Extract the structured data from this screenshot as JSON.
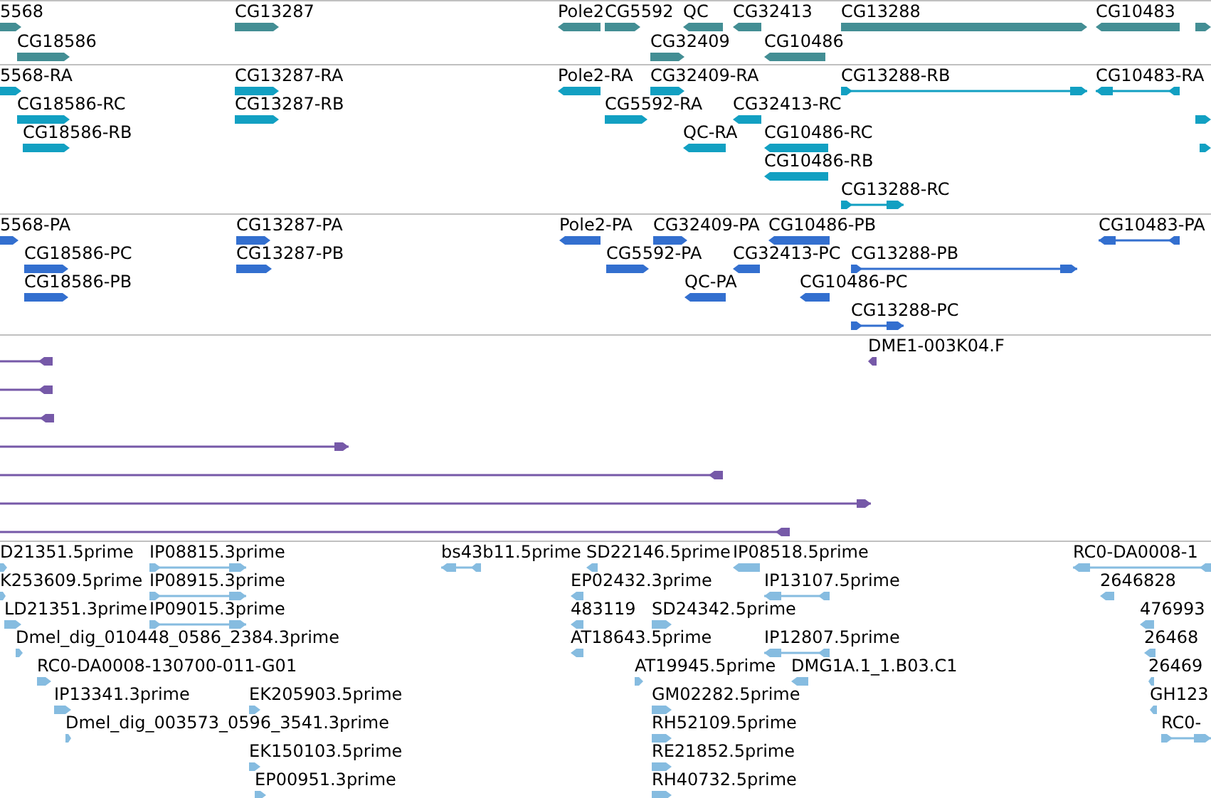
{
  "tracks": [
    {
      "color": "#438e94",
      "features": [
        {
          "label": "5568",
          "forward": true,
          "kind": "block"
        },
        {
          "label": "CG18586",
          "forward": true,
          "kind": "block"
        },
        {
          "label": "CG13287",
          "forward": true,
          "kind": "block"
        },
        {
          "label": "Pole2",
          "forward": false,
          "kind": "block"
        },
        {
          "label": "CG5592",
          "forward": true,
          "kind": "block"
        },
        {
          "label": "QC",
          "forward": false,
          "kind": "block"
        },
        {
          "label": "CG32409",
          "forward": true,
          "kind": "block"
        },
        {
          "label": "CG32413",
          "forward": false,
          "kind": "block"
        },
        {
          "label": "CG10486",
          "forward": false,
          "kind": "block"
        },
        {
          "label": "CG13288",
          "forward": true,
          "kind": "block"
        },
        {
          "label": "CG10483",
          "forward": false,
          "kind": "block"
        },
        {
          "forward": true,
          "kind": "block"
        }
      ]
    },
    {
      "color": "#12a0c2",
      "features": [
        {
          "label": "5568-RA",
          "forward": true,
          "kind": "block"
        },
        {
          "label": "CG18586-RC",
          "forward": true,
          "kind": "block"
        },
        {
          "label": "CG18586-RB",
          "forward": true,
          "kind": "block"
        },
        {
          "label": "CG13287-RA",
          "forward": true,
          "kind": "block"
        },
        {
          "label": "CG13287-RB",
          "forward": true,
          "kind": "block"
        },
        {
          "label": "Pole2-RA",
          "forward": false,
          "kind": "block"
        },
        {
          "label": "CG32409-RA",
          "forward": true,
          "kind": "block"
        },
        {
          "label": "CG5592-RA",
          "forward": true,
          "kind": "block"
        },
        {
          "label": "QC-RA",
          "forward": false,
          "kind": "block"
        },
        {
          "label": "CG32413-RC",
          "forward": false,
          "kind": "block"
        },
        {
          "label": "CG10486-RC",
          "forward": false,
          "kind": "block"
        },
        {
          "label": "CG10486-RB",
          "forward": false,
          "kind": "block"
        },
        {
          "label": "CG13288-RB",
          "forward": true,
          "kind": "spliced"
        },
        {
          "label": "CG13288-RC",
          "forward": true,
          "kind": "spliced"
        },
        {
          "label": "CG10483-RA",
          "forward": false,
          "kind": "spliced"
        },
        {
          "forward": true,
          "kind": "block"
        },
        {
          "forward": true,
          "kind": "block"
        }
      ]
    },
    {
      "color": "#336fcf",
      "features": [
        {
          "label": "5568-PA",
          "forward": true,
          "kind": "block"
        },
        {
          "label": "CG18586-PC",
          "forward": true,
          "kind": "block"
        },
        {
          "label": "CG18586-PB",
          "forward": true,
          "kind": "block"
        },
        {
          "label": "CG13287-PA",
          "forward": true,
          "kind": "block"
        },
        {
          "label": "CG13287-PB",
          "forward": true,
          "kind": "block"
        },
        {
          "label": "Pole2-PA",
          "forward": false,
          "kind": "block"
        },
        {
          "label": "CG32409-PA",
          "forward": true,
          "kind": "block"
        },
        {
          "label": "CG5592-PA",
          "forward": true,
          "kind": "block"
        },
        {
          "label": "QC-PA",
          "forward": false,
          "kind": "block"
        },
        {
          "label": "CG32413-PC",
          "forward": false,
          "kind": "block"
        },
        {
          "label": "CG10486-PB",
          "forward": false,
          "kind": "block"
        },
        {
          "label": "CG10486-PC",
          "forward": false,
          "kind": "block"
        },
        {
          "label": "CG13288-PB",
          "forward": true,
          "kind": "spliced"
        },
        {
          "label": "CG13288-PC",
          "forward": true,
          "kind": "spliced"
        },
        {
          "label": "CG10483-PA",
          "forward": false,
          "kind": "spliced"
        }
      ]
    },
    {
      "color": "#7659a8",
      "features": [
        {
          "label": "DME1-003K04.F",
          "forward": false,
          "kind": "block"
        },
        {
          "forward": false,
          "kind": "line"
        },
        {
          "forward": false,
          "kind": "line"
        },
        {
          "forward": false,
          "kind": "line"
        },
        {
          "forward": true,
          "kind": "line"
        },
        {
          "forward": false,
          "kind": "line"
        },
        {
          "forward": true,
          "kind": "line"
        },
        {
          "forward": false,
          "kind": "line"
        }
      ]
    },
    {
      "color": "#86bce0",
      "features": [
        {
          "label": "D21351.5prime",
          "forward": true,
          "kind": "block"
        },
        {
          "label": "IP08815.3prime",
          "forward": true,
          "kind": "spliced"
        },
        {
          "label": "bs43b11.5prime",
          "forward": false,
          "kind": "spliced"
        },
        {
          "label": "SD22146.5prime",
          "forward": false,
          "kind": "block"
        },
        {
          "label": "IP08518.5prime",
          "forward": false,
          "kind": "block"
        },
        {
          "label": "RC0-DA0008-1",
          "forward": false,
          "kind": "spliced"
        },
        {
          "label": "K253609.5prime",
          "forward": true,
          "kind": "block"
        },
        {
          "label": "IP08915.3prime",
          "forward": true,
          "kind": "spliced"
        },
        {
          "label": "EP02432.3prime",
          "forward": false,
          "kind": "block"
        },
        {
          "label": "IP13107.5prime",
          "forward": false,
          "kind": "spliced"
        },
        {
          "label": "2646828",
          "forward": false,
          "kind": "block"
        },
        {
          "label": "LD21351.3prime",
          "forward": true,
          "kind": "block"
        },
        {
          "label": "IP09015.3prime",
          "forward": true,
          "kind": "spliced"
        },
        {
          "label": "483119",
          "forward": false,
          "kind": "block"
        },
        {
          "label": "SD24342.5prime",
          "forward": true,
          "kind": "block"
        },
        {
          "label": "476993",
          "forward": false,
          "kind": "block"
        },
        {
          "label": "Dmel_dig_010448_0586_2384.3prime",
          "forward": true,
          "kind": "block"
        },
        {
          "label": "AT18643.5prime",
          "forward": false,
          "kind": "block"
        },
        {
          "label": "IP12807.5prime",
          "forward": false,
          "kind": "spliced"
        },
        {
          "label": "26468",
          "forward": false,
          "kind": "block"
        },
        {
          "label": "RC0-DA0008-130700-011-G01",
          "forward": true,
          "kind": "block"
        },
        {
          "label": "AT19945.5prime",
          "forward": true,
          "kind": "block"
        },
        {
          "label": "DMG1A.1_1.B03.C1",
          "forward": false,
          "kind": "block"
        },
        {
          "label": "26469",
          "forward": false,
          "kind": "block"
        },
        {
          "label": "IP13341.3prime",
          "forward": true,
          "kind": "block"
        },
        {
          "label": "EK205903.5prime",
          "forward": true,
          "kind": "block"
        },
        {
          "label": "GM02282.5prime",
          "forward": true,
          "kind": "block"
        },
        {
          "label": "GH123",
          "forward": false,
          "kind": "block"
        },
        {
          "label": "Dmel_dig_003573_0596_3541.3prime",
          "forward": true,
          "kind": "block"
        },
        {
          "label": "RH52109.5prime",
          "forward": true,
          "kind": "block"
        },
        {
          "label": "RC0-",
          "forward": true,
          "kind": "spliced"
        },
        {
          "label": "EK150103.5prime",
          "forward": true,
          "kind": "block"
        },
        {
          "label": "RE21852.5prime",
          "forward": true,
          "kind": "block"
        },
        {
          "label": "EP00951.3prime",
          "forward": true,
          "kind": "block"
        },
        {
          "label": "RH40732.5prime",
          "forward": true,
          "kind": "block"
        }
      ]
    }
  ]
}
